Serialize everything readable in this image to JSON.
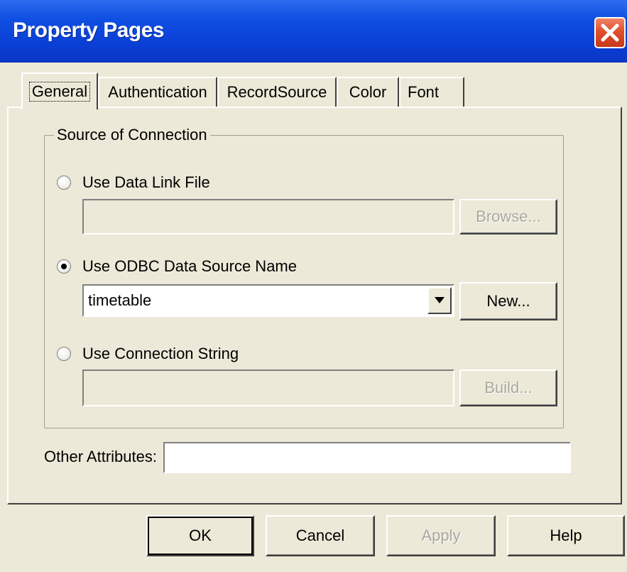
{
  "window": {
    "title": "Property Pages",
    "close_icon": "close-icon"
  },
  "tabs": [
    {
      "label": "General",
      "selected": true
    },
    {
      "label": "Authentication",
      "selected": false
    },
    {
      "label": "RecordSource",
      "selected": false
    },
    {
      "label": "Color",
      "selected": false
    },
    {
      "label": "Font",
      "selected": false
    }
  ],
  "source_group": {
    "legend": "Source of Connection",
    "option_data_link": {
      "label": "Use Data Link File",
      "checked": false,
      "field_value": "",
      "browse_label": "Browse..."
    },
    "option_odbc": {
      "label": "Use ODBC Data Source Name",
      "checked": true,
      "selected_value": "timetable",
      "new_label": "New..."
    },
    "option_connection_string": {
      "label": "Use Connection String",
      "checked": false,
      "field_value": "",
      "build_label": "Build..."
    }
  },
  "other_attributes": {
    "label": "Other Attributes:",
    "value": ""
  },
  "footer": {
    "ok_label": "OK",
    "cancel_label": "Cancel",
    "apply_label": "Apply",
    "help_label": "Help"
  },
  "colors": {
    "titlebar": "#0a3fd6",
    "client": "#ece9d8",
    "close": "#e0502a"
  }
}
